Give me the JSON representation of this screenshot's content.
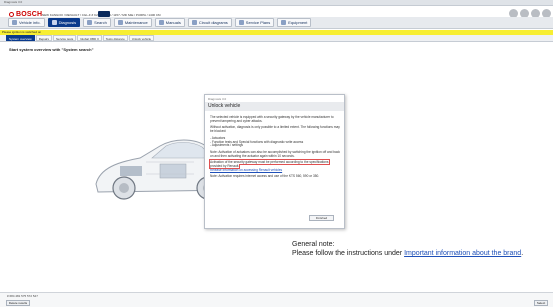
{
  "window": {
    "title": "Diagnosis 3.0"
  },
  "header": {
    "brand": "BOSCH",
    "breadcrumb": "NEW KANGOO / RENAULT / CGL-F # K21B RT R3 / 1157 / MD S4E / PURPA / 1400 CM",
    "icons": [
      "print-icon",
      "help-icon",
      "settings-icon",
      "user-icon"
    ]
  },
  "toolbar": {
    "items": [
      {
        "label": "Vehicle info.",
        "icon": "car-info-icon",
        "active": false
      },
      {
        "label": "Diagnosis",
        "icon": "diagnosis-icon",
        "active": true
      },
      {
        "label": "Search",
        "icon": "search-icon",
        "active": false
      },
      {
        "label": "Maintenance",
        "icon": "maintenance-icon",
        "active": false
      },
      {
        "label": "Manuals",
        "icon": "manuals-icon",
        "active": false
      },
      {
        "label": "Circuit diagrams",
        "icon": "circuit-icon",
        "active": false
      },
      {
        "label": "Service Plans",
        "icon": "service-plan-icon",
        "active": false
      },
      {
        "label": "Equipment",
        "icon": "equipment-icon",
        "active": false
      }
    ]
  },
  "warning_bar": {
    "text": "Please ignition is switched on"
  },
  "tabs": [
    {
      "label": "System overview",
      "active": true
    },
    {
      "label": "Repairs",
      "active": false
    },
    {
      "label": "Service tests",
      "active": false
    },
    {
      "label": "Global OBD II",
      "active": false
    },
    {
      "label": "Tests distance",
      "active": false
    },
    {
      "label": "Unlock vehicle",
      "active": false
    }
  ],
  "main": {
    "start_text": "Start system overview with \"System search\""
  },
  "dialog": {
    "window_title": "Diagnosis 3.0",
    "heading": "Unlock vehicle",
    "paragraphs": [
      "The selected vehicle is equipped with a security gateway by the vehicle manufacturer to prevent tampering and cyber attacks.",
      "Without activation, diagnosis is only possible to a limited extent. The following functions may be blocked:",
      "- Actuators\n- Function tests and Special functions with diagnostic write access\n- Adjustments / settings",
      "Note: Activation of actuators can also be accomplished by switching the ignition off and back on and then activating the actuator again within 10 seconds."
    ],
    "highlight_text": "Activation of the security gateway must be performed according to the specifications provided by Renault.",
    "link_text": "Release information on accessing Renault vehicles",
    "footnote": "Note: Activation requires internet access and use of the KTS 560, 590 or 350.",
    "finish_label": "Finished"
  },
  "note": {
    "heading": "General note:",
    "text_before": "Please follow the instructions under ",
    "link": "Important information about the brand",
    "text_after": "."
  },
  "status": {
    "id": "# 684 481 575 572 547",
    "left_button": "Delete results",
    "right_button": "Select"
  },
  "colors": {
    "bosch_red": "#cc0000",
    "accent_blue": "#0a3a8c",
    "warning_yellow": "#f7ee32"
  }
}
